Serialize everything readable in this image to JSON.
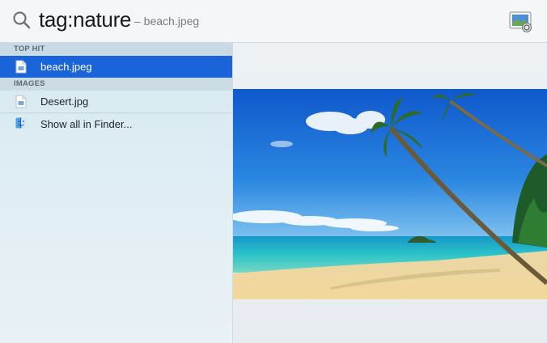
{
  "search": {
    "query": "tag:nature",
    "suffix": "– beach.jpeg"
  },
  "app_icon": "preview-app-icon",
  "sections": {
    "top_hit": {
      "header": "TOP HIT",
      "items": [
        {
          "label": "beach.jpeg",
          "icon": "jpeg-file-icon",
          "selected": true
        }
      ]
    },
    "images": {
      "header": "IMAGES",
      "items": [
        {
          "label": "Desert.jpg",
          "icon": "jpg-file-icon",
          "selected": false
        }
      ]
    }
  },
  "show_all": {
    "label": "Show all in Finder...",
    "icon": "finder-icon"
  },
  "colors": {
    "selection": "#1a64d9",
    "sky_top": "#0f5fd0",
    "sea": "#22b3c9",
    "sand": "#f0d79a"
  }
}
